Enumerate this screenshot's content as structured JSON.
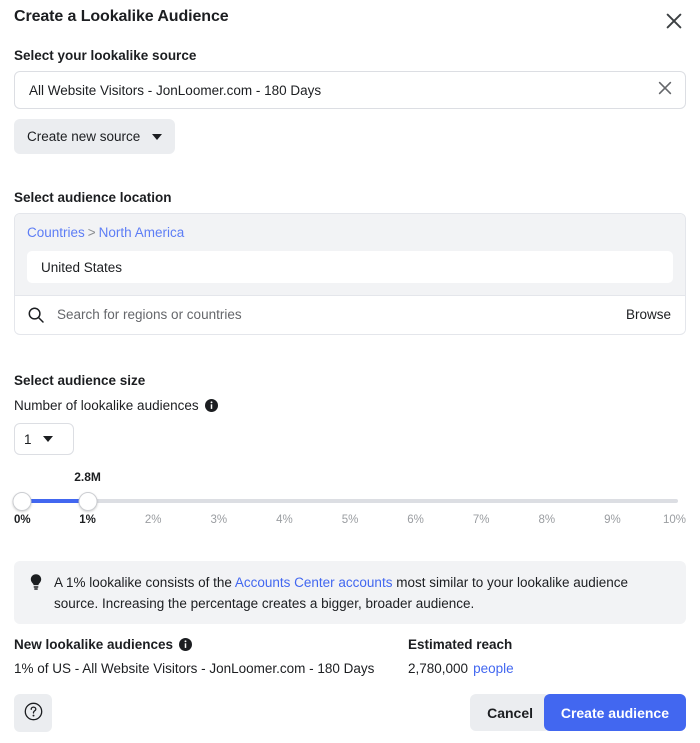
{
  "dialog": {
    "title": "Create a Lookalike Audience",
    "close_icon": "close-icon"
  },
  "source": {
    "label": "Select your lookalike source",
    "value": "All Website Visitors - JonLoomer.com - 180 Days",
    "clear_icon": "close-icon",
    "create_new_label": "Create new source",
    "caret_icon": "chevron-down-icon"
  },
  "location": {
    "label": "Select audience location",
    "breadcrumb": {
      "root": "Countries",
      "separator": ">",
      "current": "North America"
    },
    "selected": "United States",
    "search_placeholder": "Search for regions or countries",
    "search_value": "",
    "search_icon": "search-icon",
    "browse_label": "Browse"
  },
  "size": {
    "label": "Select audience size",
    "count_label": "Number of lookalike audiences",
    "count_info_icon": "info-icon",
    "count_value": "1",
    "count_caret_icon": "chevron-down-icon",
    "slider": {
      "reach_bubble": "2.8M",
      "min_percent": 0,
      "max_percent": 10,
      "handle_low_percent": 0,
      "handle_high_percent": 1,
      "fill_color": "#4267f0",
      "track_color": "#dcdee3",
      "ticks": [
        {
          "label": "0%",
          "value": 0,
          "active": true
        },
        {
          "label": "1%",
          "value": 1,
          "active": true
        },
        {
          "label": "2%",
          "value": 2,
          "active": false
        },
        {
          "label": "3%",
          "value": 3,
          "active": false
        },
        {
          "label": "4%",
          "value": 4,
          "active": false
        },
        {
          "label": "5%",
          "value": 5,
          "active": false
        },
        {
          "label": "6%",
          "value": 6,
          "active": false
        },
        {
          "label": "7%",
          "value": 7,
          "active": false
        },
        {
          "label": "8%",
          "value": 8,
          "active": false
        },
        {
          "label": "9%",
          "value": 9,
          "active": false
        },
        {
          "label": "10%",
          "value": 10,
          "active": false
        }
      ]
    }
  },
  "tip": {
    "icon": "lightbulb-icon",
    "text_before": "A 1% lookalike consists of the ",
    "link": "Accounts Center accounts",
    "text_after": " most similar to your lookalike audience source. Increasing the percentage creates a bigger, broader audience."
  },
  "summary": {
    "col_audiences_label": "New lookalike audiences",
    "col_audiences_info_icon": "info-icon",
    "col_reach_label": "Estimated reach",
    "audience_name": "1% of US - All Website Visitors - JonLoomer.com - 180 Days",
    "reach_value": "2,780,000",
    "reach_unit": "people"
  },
  "footer": {
    "help_icon": "question-mark-circle-icon",
    "cancel_label": "Cancel",
    "create_label": "Create audience",
    "primary_color": "#4267f0"
  }
}
